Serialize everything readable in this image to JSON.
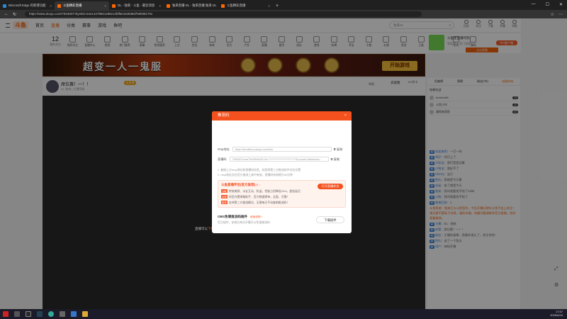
{
  "browser": {
    "tabs": [
      {
        "label": "Microsoft Edge 的新增功能",
        "active": false
      },
      {
        "label": "斗鱼精彩直播",
        "active": true
      },
      {
        "label": "DL - 独来 - 斗鱼 - 最近消息",
        "active": false
      },
      {
        "label": "独来直播 DL - 独来直播 独来 DL",
        "active": false
      },
      {
        "label": "斗鱼精彩直播",
        "active": false
      }
    ],
    "url": "https://www.douyu.com/7934007?dyshid=54e143-f9921485e13fdf5e152838d7b80081791"
  },
  "topnav": {
    "brand": "斗鱼",
    "items": [
      "首页",
      "直播",
      "分类",
      "赛事",
      "游戏",
      "鱼吧"
    ],
    "search_placeholder": "独来DL",
    "icons": [
      "历史",
      "关注",
      "下载",
      "开播",
      "消息",
      "充值",
      "等级"
    ]
  },
  "catbar": {
    "follow_count": "12",
    "follow_label": "我的关注",
    "categories": [
      "我的关注",
      "直播中心",
      "鱼吧",
      "热门推荐",
      "赛事",
      "鱼吧推荐",
      "上分",
      "赏金",
      "体育",
      "官方",
      "户外",
      "直播",
      "星秀",
      "组队",
      "游戏",
      "吃喝",
      "寻宝",
      "卡普",
      "幻想",
      "竞技",
      "王者",
      "开火",
      "吃鸡",
      "舞蹈"
    ],
    "live_show": {
      "title": "斗鱼星直播时刻",
      "subtitle": "等级第一 热门直播",
      "button": "点击观看"
    },
    "vip_button": "PC客户端"
  },
  "banner": {
    "title": "超变一人一鬼服",
    "play_button": "开始游戏"
  },
  "room": {
    "title": "席位赛！一！！",
    "meta": "ID: 独来 | 主播等级",
    "badge": "去直播",
    "r1": "举报",
    "r2": "去观看",
    "r3": "100余卡"
  },
  "player": {
    "wait_text_prefix": "直播可以",
    "wait_text_highlight": "下载客户端",
    "wait_text_suffix": "获得直播开播提醒"
  },
  "sidebar": {
    "tabs": [
      "贡献榜",
      "周榜",
      "粉丝(76)",
      "钻粉(36)"
    ],
    "rank_title": "钻粉在这",
    "rank_rows": [
      {
        "name": "bestfun88",
        "level": "15"
      },
      {
        "name": "斗鱼小伙",
        "level": "12"
      },
      {
        "name": "凝视者萌鱼",
        "level": "10"
      }
    ],
    "chat": [
      {
        "user": "欢迎来到",
        "text": "一打一样"
      },
      {
        "user": "鸡仔",
        "text": "鸡仔上了"
      },
      {
        "user": "贝佳佳",
        "text": "我们是是还算"
      },
      {
        "user": "小狗宝",
        "text": "我佐不了"
      },
      {
        "user": "Cherry",
        "text": "宝贝"
      },
      {
        "user": "鱼丸",
        "text": "那就是今天算"
      },
      {
        "user": "欢迎",
        "text": "来了就是今天"
      },
      {
        "user": "独来",
        "text": "我叫我要找不找了1356"
      },
      {
        "user": "小狗",
        "text": "我叫我要找不找了"
      },
      {
        "user": "独来回合",
        "text": "1"
      }
    ],
    "notice": "斗鱼系统：独来已与斗鱼签约，今后开播记得在斗鱼平台上关注！请注意不要私下交易，谨防诈骗，如遇问题请联系官方客服。祝你观看愉快。",
    "chat2": [
      {
        "user": "主播",
        "text": "DL - 独来"
      },
      {
        "user": "房管",
        "text": "席位赛！一！！"
      },
      {
        "user": "粉丝",
        "text": "主播你真棒，我看你很久了，关注你啦！"
      },
      {
        "user": "鱼丸",
        "text": "送了一个鱼丸"
      },
      {
        "user": "用户",
        "text": "神秘开播"
      }
    ]
  },
  "dialog": {
    "title": "推流码",
    "rtmp_label": "rtmp地址",
    "rtmp_value": "rtmp://sendfw1a.douyu.com/live",
    "key_label": "直播码",
    "key_value": "7934007rorm79dVBM1&0?fo=**************************&Lcconf=9dbxiniceu",
    "copy": "复制",
    "notes": [
      "1. 复制上方rtmp地址和直播码信息，粘贴到第三方推流软件对应位置",
      "2. rtmp地址仅在官方推流工具中有效，直播码有效期为30分钟"
    ],
    "promo": {
      "title": "斗鱼直播伴侣(官方推荐)",
      "hint": "使用说明 >",
      "button": "打开直播伴侣",
      "lines": [
        {
          "key": "功能",
          "text": "特效美颜、水友互动、防盗，性能占用降低20%，超低延迟"
        },
        {
          "key": "优势",
          "text": "伴侣内置弹幕助手、官方数据榜单，全面、可靠！"
        },
        {
          "key": "推荐",
          "text": "支持第三方推流模式，无需每天手动复制推流码！"
        }
      ]
    },
    "obs": {
      "title": "OBS免填推流码插件",
      "hint": "使用说明 >",
      "desc": "官方插件，安装后每次开播可以免填推流码",
      "button": "下载插件"
    }
  },
  "taskbar": {
    "time": "17:57",
    "date": "2025/6/15"
  },
  "colors": {
    "accent": "#f5610a",
    "dialog_header": "#f4511e"
  }
}
